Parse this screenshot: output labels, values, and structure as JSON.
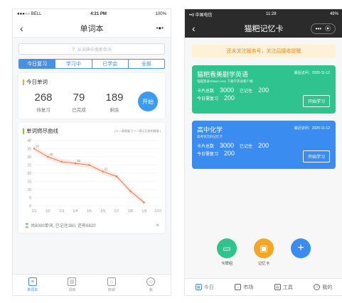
{
  "left": {
    "status": {
      "carrier": "●●●○○ BELL",
      "time": "4:21 PM",
      "battery": "100%"
    },
    "nav": {
      "back": "‹",
      "title": "单词本",
      "more": "•●•"
    },
    "search": {
      "placeholder": "从词典中搜索单词"
    },
    "tabs": [
      "今日复习",
      "学习中",
      "已学会",
      "全部"
    ],
    "today": {
      "title": "今日单词",
      "stats": [
        {
          "value": "268",
          "label": "待复习"
        },
        {
          "value": "79",
          "label": "已完成"
        },
        {
          "value": "189",
          "label": "剩余"
        }
      ],
      "start": "开始"
    },
    "burndown": {
      "title": "单词燃尽曲线",
      "legend": "[ X 一表格复习  Y 一表示已经的数量 ]",
      "footer": "共8000单词, 已记住380, 还有6820"
    },
    "tabbar": [
      "单词本",
      "词库",
      "商城",
      "我"
    ]
  },
  "right": {
    "status": {
      "carrier": "••ll 中国电信",
      "time": "11:28",
      "battery": "49%"
    },
    "nav": {
      "back": "‹",
      "title": "猫粑记忆卡"
    },
    "notice": "还未关注服务号，关注后接收提醒",
    "decks": [
      {
        "title": "猫粑看美剧学英语",
        "visit": "最后访问：2020-11-12",
        "sub": "电脑登录cfaaen.com 下载学英语客户端",
        "total_label": "卡片总数",
        "total": "3000",
        "mem_label": "已记住",
        "mem": "200",
        "review_label": "今日需复习",
        "review": "200",
        "button": "开始学习"
      },
      {
        "title": "高中化学",
        "visit": "最近访问：2020-11-12",
        "sub": "高考状元的记忆卡",
        "total_label": "卡片总数",
        "total": "3000",
        "mem_label": "已记住",
        "mem": "200",
        "review_label": "今日需复习",
        "review": "200",
        "button": "开始学习"
      }
    ],
    "fabs": [
      {
        "label": "卡牌组"
      },
      {
        "label": "记忆卡"
      },
      {
        "label": ""
      }
    ],
    "tabbar": [
      "今日",
      "市场",
      "工具",
      "我的"
    ]
  },
  "chart_data": {
    "type": "line",
    "title": "单词燃尽曲线",
    "x": [
      "1/1",
      "1/2",
      "1/3",
      "1/4",
      "1/5",
      "1/6",
      "1/7",
      "1/8",
      "1/9",
      "1/10"
    ],
    "series": [
      {
        "values": [
          35,
          30,
          27,
          26,
          25,
          21,
          18,
          9,
          2,
          null
        ]
      }
    ],
    "point_labels": [
      "35",
      "30",
      "",
      "26",
      "",
      "21",
      "",
      "",
      "",
      ""
    ],
    "ylim": [
      0,
      40
    ],
    "yticks": [
      0,
      5,
      10,
      15,
      20,
      25,
      30,
      35,
      40
    ],
    "colors": {
      "line": "#e8784d",
      "area": "#fbe3d8"
    }
  }
}
